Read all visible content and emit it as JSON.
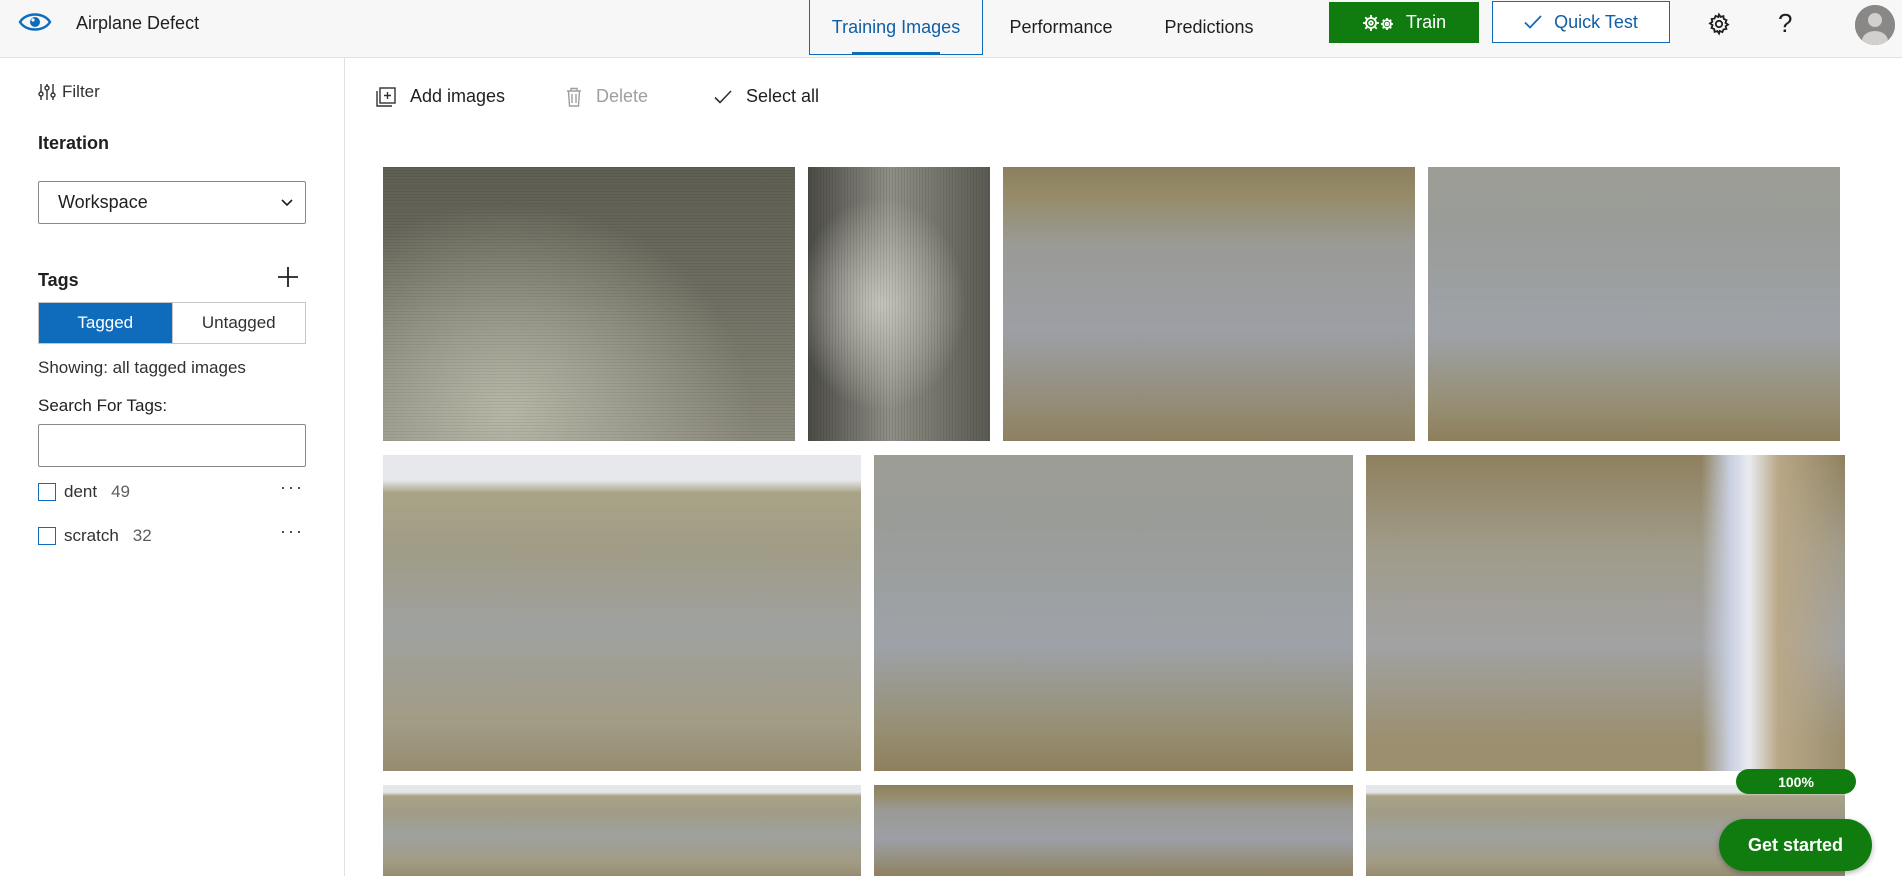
{
  "app": {
    "project_name": "Airplane Defect"
  },
  "nav": {
    "tabs": [
      {
        "label": "Training Images",
        "active": true
      },
      {
        "label": "Performance",
        "active": false
      },
      {
        "label": "Predictions",
        "active": false
      }
    ]
  },
  "toolbar": {
    "train_label": "Train",
    "quick_test_label": "Quick Test",
    "help_glyph": "?"
  },
  "sidebar": {
    "filter_label": "Filter",
    "iteration_title": "Iteration",
    "iteration_value": "Workspace",
    "tags_title": "Tags",
    "tagged_label": "Tagged",
    "untagged_label": "Untagged",
    "showing_text": "Showing: all tagged images",
    "search_label": "Search For Tags:",
    "search_value": "",
    "tags": [
      {
        "name": "dent",
        "count": "49",
        "more": "···"
      },
      {
        "name": "scratch",
        "count": "32",
        "more": "···"
      }
    ]
  },
  "commands": {
    "add_images": "Add images",
    "delete": "Delete",
    "select_all": "Select all"
  },
  "images": [
    {
      "name": "training-image-1",
      "style": "t1"
    },
    {
      "name": "training-image-2",
      "style": "t2"
    },
    {
      "name": "training-image-3",
      "style": "t-steel"
    },
    {
      "name": "training-image-4",
      "style": "t-steel2"
    },
    {
      "name": "training-image-5",
      "style": "t-edge"
    },
    {
      "name": "training-image-6",
      "style": "t-steel2"
    },
    {
      "name": "training-image-7",
      "style": "t-bright"
    },
    {
      "name": "training-image-8",
      "style": "t-edge"
    },
    {
      "name": "training-image-9",
      "style": "t-steel"
    },
    {
      "name": "training-image-10",
      "style": "t-edge"
    }
  ],
  "status": {
    "progress_text": "100%",
    "progress_value": 1.0,
    "get_started_label": "Get started"
  },
  "colors": {
    "brand_blue": "#0f6cbd",
    "train_green": "#107c10"
  },
  "icons": [
    "eye-icon",
    "gear-icon",
    "help-icon",
    "avatar",
    "filter-icon",
    "plus-icon",
    "add-images-icon",
    "trash-icon",
    "checkmark-icon",
    "chevron-down-icon"
  ]
}
